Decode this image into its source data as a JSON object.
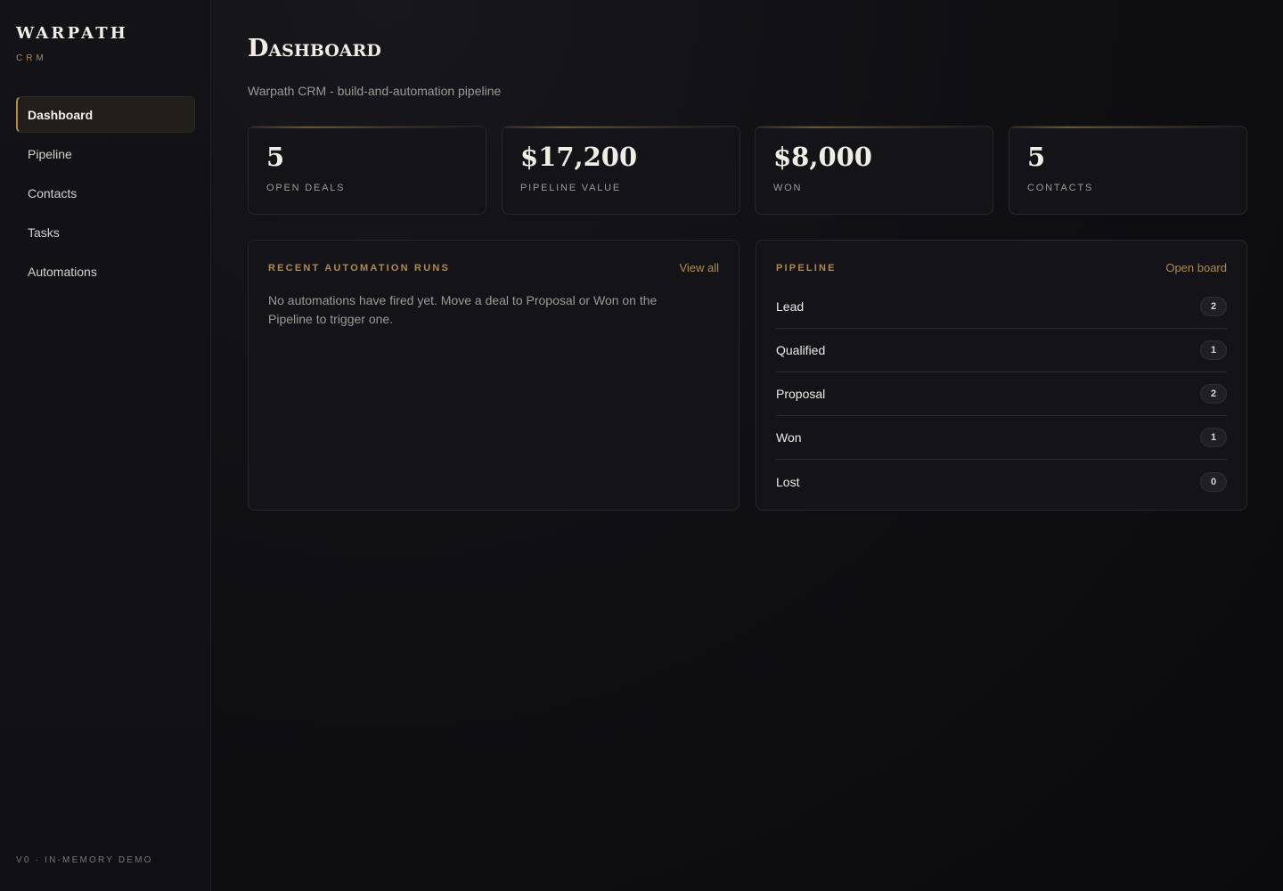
{
  "sidebar": {
    "brand": {
      "name": "WARPATH",
      "sub": "CRM"
    },
    "nav": [
      {
        "label": "Dashboard",
        "active": true
      },
      {
        "label": "Pipeline",
        "active": false
      },
      {
        "label": "Contacts",
        "active": false
      },
      {
        "label": "Tasks",
        "active": false
      },
      {
        "label": "Automations",
        "active": false
      }
    ],
    "footer": "V0 · IN-MEMORY DEMO"
  },
  "header": {
    "title": "Dashboard",
    "subtitle": "Warpath CRM - build-and-automation pipeline"
  },
  "stats": [
    {
      "value": "5",
      "label": "OPEN DEALS"
    },
    {
      "value": "$17,200",
      "label": "PIPELINE VALUE"
    },
    {
      "value": "$8,000",
      "label": "WON"
    },
    {
      "value": "5",
      "label": "CONTACTS"
    }
  ],
  "automation_panel": {
    "title": "RECENT AUTOMATION RUNS",
    "link": "View all",
    "empty_text": "No automations have fired yet. Move a deal to Proposal or Won on the Pipeline to trigger one."
  },
  "pipeline_panel": {
    "title": "PIPELINE",
    "link": "Open board",
    "stages": [
      {
        "name": "Lead",
        "count": "2"
      },
      {
        "name": "Qualified",
        "count": "1"
      },
      {
        "name": "Proposal",
        "count": "2"
      },
      {
        "name": "Won",
        "count": "1"
      },
      {
        "name": "Lost",
        "count": "0"
      }
    ]
  },
  "colors": {
    "accent": "#b08a4e",
    "background": "#0d0d10",
    "card": "#141418"
  }
}
